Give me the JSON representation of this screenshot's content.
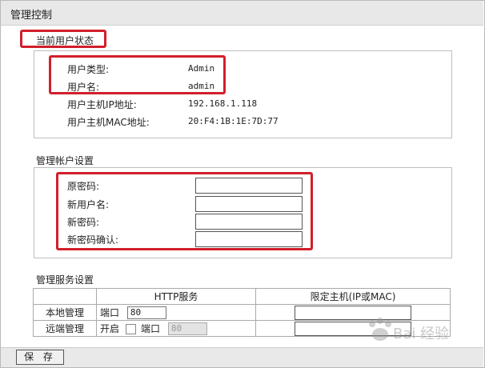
{
  "title": "管理控制",
  "current_user": {
    "heading": "当前用户状态",
    "rows": [
      {
        "label": "用户类型:",
        "value": "Admin"
      },
      {
        "label": "用户名:",
        "value": "admin"
      },
      {
        "label": "用户主机IP地址:",
        "value": "192.168.1.118"
      },
      {
        "label": "用户主机MAC地址:",
        "value": "20:F4:1B:1E:7D:77"
      }
    ]
  },
  "account": {
    "heading": "管理帐户设置",
    "fields": [
      {
        "label": "原密码:",
        "value": ""
      },
      {
        "label": "新用户名:",
        "value": ""
      },
      {
        "label": "新密码:",
        "value": ""
      },
      {
        "label": "新密码确认:",
        "value": ""
      }
    ]
  },
  "service": {
    "heading": "管理服务设置",
    "col_http": "HTTP服务",
    "col_host": "限定主机(IP或MAC)",
    "local": {
      "label": "本地管理",
      "port_label": "端口",
      "port": "80"
    },
    "remote": {
      "label": "远端管理",
      "enable_label": "开启",
      "port_label": "端口",
      "port": "80",
      "enabled": false
    }
  },
  "save_label": "保 存",
  "watermark": "Bai 经验"
}
